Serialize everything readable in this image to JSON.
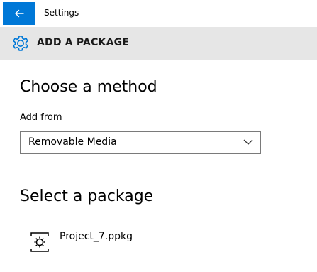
{
  "window": {
    "title": "Settings",
    "back_icon": "back-arrow-icon",
    "accent_color": "#0078d7"
  },
  "header": {
    "icon": "gear-icon",
    "title": "ADD A PACKAGE",
    "background_color": "#e6e6e6"
  },
  "method": {
    "heading": "Choose a method",
    "add_from_label": "Add from",
    "dropdown": {
      "selected": "Removable Media",
      "icon": "chevron-down-icon"
    }
  },
  "package": {
    "heading": "Select a package",
    "items": [
      {
        "name": "Project_7.ppkg",
        "icon": "provisioning-package-icon"
      }
    ]
  }
}
